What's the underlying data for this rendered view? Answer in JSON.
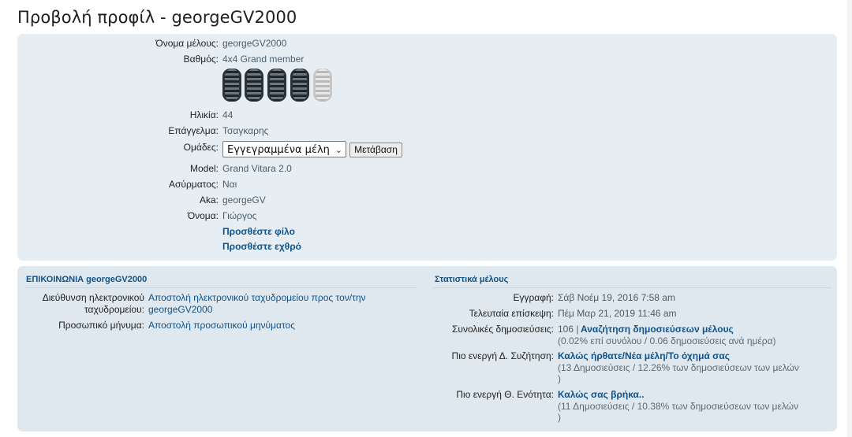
{
  "page": {
    "title": "Προβολή προφίλ - georgeGV2000"
  },
  "profile": {
    "username_label": "Όνομα μέλους:",
    "username": "georgeGV2000",
    "rank_label": "Βαθμός:",
    "rank": "4x4 Grand member",
    "rank_icon": "tyres-rank-icon",
    "rank_level": "4 of 5",
    "age_label": "Ηλικία:",
    "age": "44",
    "occupation_label": "Επάγγελμα:",
    "occupation": "Τσαγκαρης",
    "groups_label": "Ομάδες:",
    "groups_selected": "Εγγεγραμμένα μέλη",
    "go_button": "Μετάβαση",
    "model_label": "Model:",
    "model": "Grand Vitara 2.0",
    "radio_label": "Ασύρματος:",
    "radio": "Ναι",
    "aka_label": "Aka:",
    "aka": "georgeGV",
    "name_label": "Όνομα:",
    "name": "Γιώργος",
    "add_friend": "Προσθέστε φίλο",
    "add_foe": "Προσθέστε εχθρό"
  },
  "contact": {
    "heading": "ΕΠΙΚΟΙΝΩΝΙΑ georgeGV2000",
    "email_label_1": "Διεύθυνση ηλεκτρονικού",
    "email_label_2": "ταχυδρομείου:",
    "email_value_1": "Αποστολή ηλεκτρονικού ταχυδρομείου προς τον/την",
    "email_value_2": "georgeGV2000",
    "pm_label": "Προσωπικό μήνυμα:",
    "pm_value": "Αποστολή προσωπικού μηνύματος"
  },
  "stats": {
    "heading": "Στατιστικά μέλους",
    "joined_label": "Εγγραφή:",
    "joined": "Σάβ Νοέμ 19, 2016 7:58 am",
    "last_visit_label": "Τελευταία επίσκεψη:",
    "last_visit": "Πέμ Μαρ 21, 2019 11:46 am",
    "posts_label": "Συνολικές δημοσιεύσεις:",
    "posts_count": "106 |",
    "posts_search": "Αναζήτηση δημοσιεύσεων μέλους",
    "posts_sub": "(0.02% επί συνόλου / 0.06 δημοσιεύσεις ανά ημέρα)",
    "active_topic_label": "Πιο ενεργή Δ. Συζήτηση:",
    "active_topic": "Καλώς ήρθατε/Νέα μέλη/Το όχημά σας",
    "active_topic_sub_1": "(13 Δημοσιεύσεις / 12.26% των δημοσιεύσεων των μελών",
    "active_topic_sub_2": ")",
    "active_section_label": "Πιο ενεργή Θ. Ενότητα:",
    "active_section": "Καλώς σας βρήκα..",
    "active_section_sub_1": "(11 Δημοσιεύσεις / 10.38% των δημοσιεύσεων των μελών",
    "active_section_sub_2": ")"
  }
}
